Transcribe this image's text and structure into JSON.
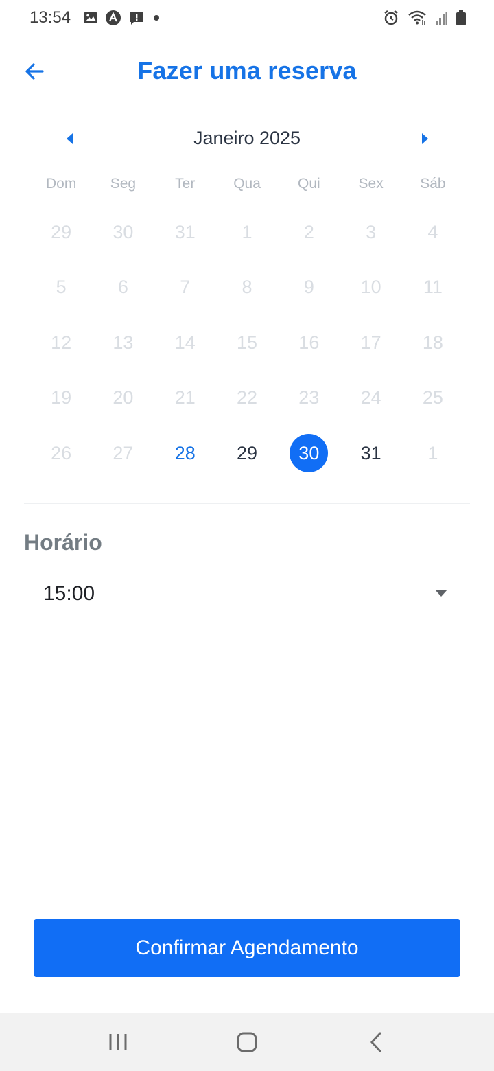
{
  "status_bar": {
    "time": "13:54",
    "left_icons": [
      "image-icon",
      "app-icon",
      "alert-icon",
      "dot-icon"
    ],
    "right_icons": [
      "alarm-icon",
      "wifi-icon",
      "signal-icon",
      "battery-icon"
    ]
  },
  "header": {
    "title": "Fazer uma reserva",
    "back_icon": "arrow-left-icon"
  },
  "calendar": {
    "month_label": "Janeiro 2025",
    "weekdays": [
      "Dom",
      "Seg",
      "Ter",
      "Qua",
      "Qui",
      "Sex",
      "Sáb"
    ],
    "days": [
      {
        "label": "29",
        "state": "disabled"
      },
      {
        "label": "30",
        "state": "disabled"
      },
      {
        "label": "31",
        "state": "disabled"
      },
      {
        "label": "1",
        "state": "disabled"
      },
      {
        "label": "2",
        "state": "disabled"
      },
      {
        "label": "3",
        "state": "disabled"
      },
      {
        "label": "4",
        "state": "disabled"
      },
      {
        "label": "5",
        "state": "disabled"
      },
      {
        "label": "6",
        "state": "disabled"
      },
      {
        "label": "7",
        "state": "disabled"
      },
      {
        "label": "8",
        "state": "disabled"
      },
      {
        "label": "9",
        "state": "disabled"
      },
      {
        "label": "10",
        "state": "disabled"
      },
      {
        "label": "11",
        "state": "disabled"
      },
      {
        "label": "12",
        "state": "disabled"
      },
      {
        "label": "13",
        "state": "disabled"
      },
      {
        "label": "14",
        "state": "disabled"
      },
      {
        "label": "15",
        "state": "disabled"
      },
      {
        "label": "16",
        "state": "disabled"
      },
      {
        "label": "17",
        "state": "disabled"
      },
      {
        "label": "18",
        "state": "disabled"
      },
      {
        "label": "19",
        "state": "disabled"
      },
      {
        "label": "20",
        "state": "disabled"
      },
      {
        "label": "21",
        "state": "disabled"
      },
      {
        "label": "22",
        "state": "disabled"
      },
      {
        "label": "23",
        "state": "disabled"
      },
      {
        "label": "24",
        "state": "disabled"
      },
      {
        "label": "25",
        "state": "disabled"
      },
      {
        "label": "26",
        "state": "disabled"
      },
      {
        "label": "27",
        "state": "disabled"
      },
      {
        "label": "28",
        "state": "today"
      },
      {
        "label": "29",
        "state": "available"
      },
      {
        "label": "30",
        "state": "selected"
      },
      {
        "label": "31",
        "state": "available"
      },
      {
        "label": "1",
        "state": "disabled"
      }
    ]
  },
  "schedule": {
    "label": "Horário",
    "selected_time": "15:00"
  },
  "confirm_button": {
    "label": "Confirmar Agendamento"
  },
  "colors": {
    "primary": "#116ef5",
    "title": "#1673e6",
    "disabled_day": "#d9dde2",
    "section_label": "#737c83"
  }
}
